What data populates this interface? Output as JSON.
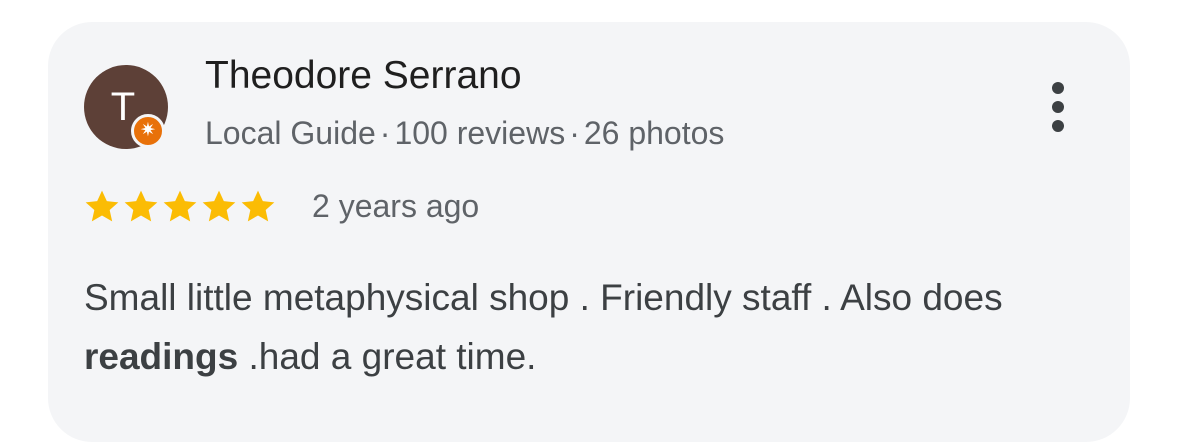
{
  "reviewer": {
    "initial": "T",
    "name": "Theodore Serrano",
    "badge": "local-guide-star-icon",
    "avatar_color": "#5d4037",
    "badge_color": "#e8710a"
  },
  "meta": {
    "guide": "Local Guide",
    "separator": "·",
    "reviews": "100 reviews",
    "photos": "26 photos"
  },
  "rating": {
    "stars": 5,
    "max": 5,
    "star_color": "#fbbc04",
    "time": "2 years ago"
  },
  "review": {
    "part1": "Small little metaphysical shop . Friendly staff . Also does ",
    "bold": "readings",
    "part2": " .had a great time."
  },
  "menu": {
    "icon": "more-vert-icon"
  }
}
